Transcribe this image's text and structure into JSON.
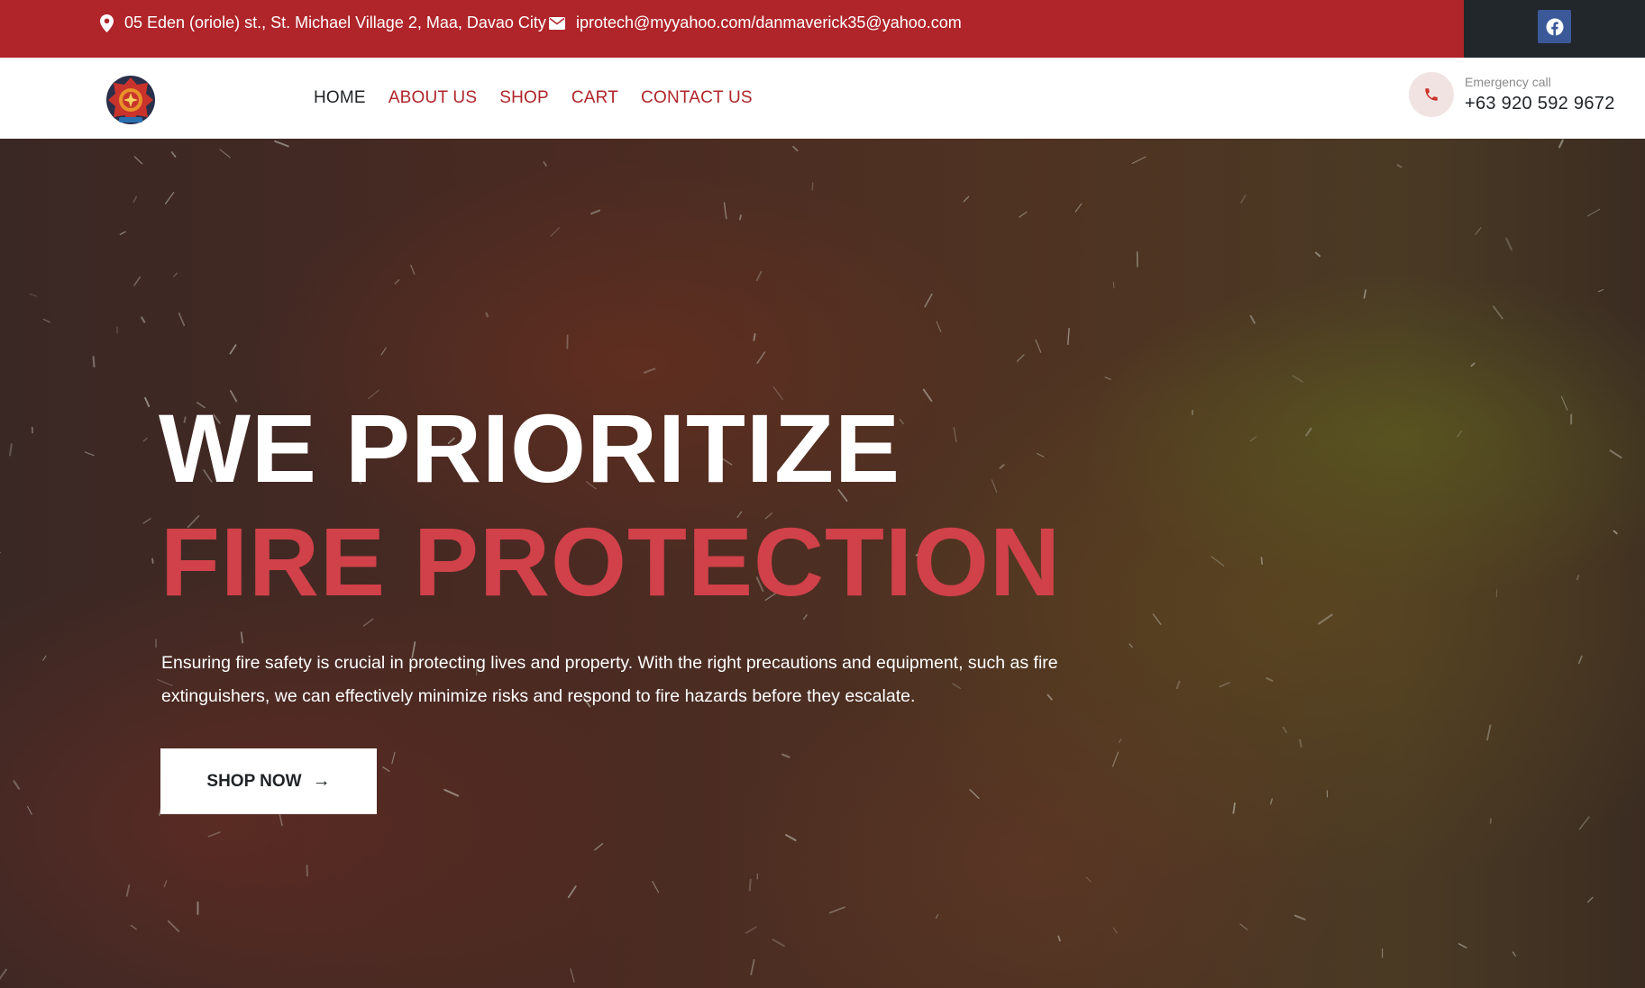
{
  "topbar": {
    "address": "05 Eden (oriole) st., St. Michael Village 2, Maa, Davao City",
    "email": "iprotech@myyahoo.com/danmaverick35@yahoo.com",
    "social_icon": "facebook-icon"
  },
  "header": {
    "nav": [
      {
        "label": "HOME",
        "active": true
      },
      {
        "label": "ABOUT US",
        "active": false
      },
      {
        "label": "SHOP",
        "active": false
      },
      {
        "label": "CART",
        "active": false
      },
      {
        "label": "CONTACT US",
        "active": false
      }
    ],
    "emergency_label": "Emergency call",
    "emergency_phone": "+63 920 592 9672"
  },
  "hero": {
    "title_line1": "WE PRIORITIZE",
    "title_line2": "FIRE PROTECTION",
    "description": "Ensuring fire safety is crucial in protecting lives and property. With the right precautions and equipment, such as fire extinguishers, we can effectively minimize risks and respond to fire hazards before they escalate.",
    "cta_label": "SHOP NOW",
    "cta_arrow": "→"
  },
  "colors": {
    "brand_red": "#b0252a",
    "accent_red": "#d0414a",
    "dark": "#22272b",
    "facebook": "#3b5998"
  }
}
